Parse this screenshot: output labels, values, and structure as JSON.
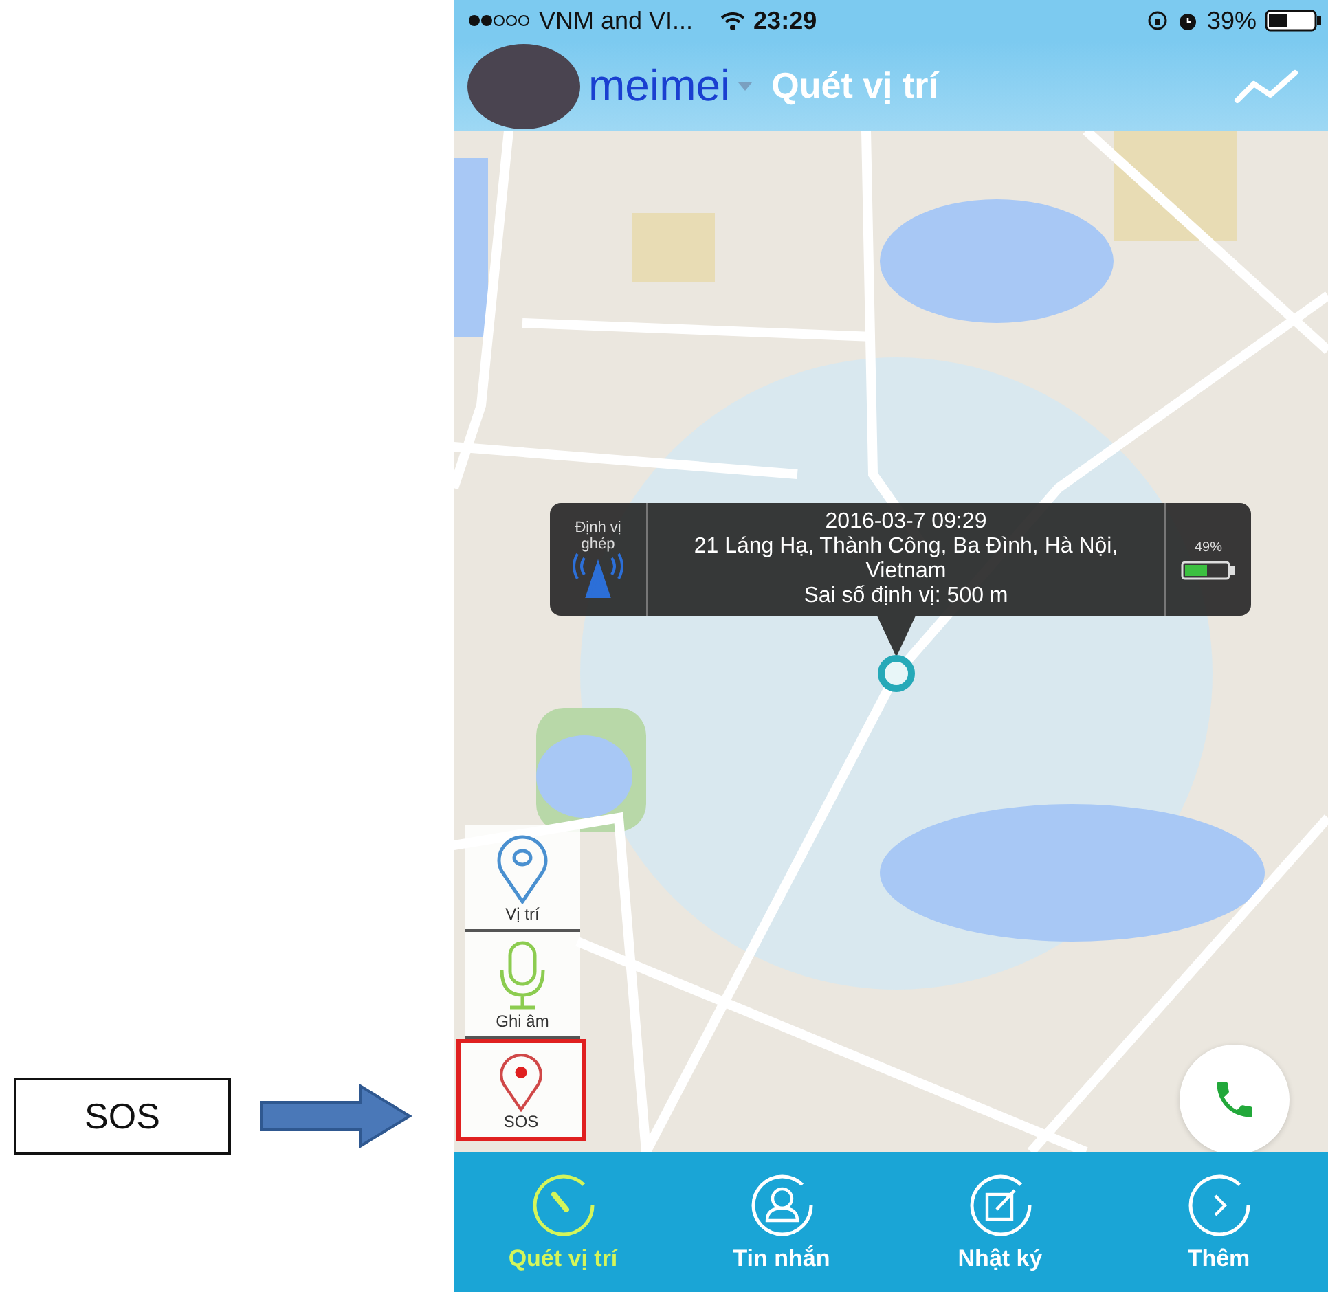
{
  "annotation": {
    "label": "SOS"
  },
  "status_bar": {
    "carrier": "VNM and VI...",
    "time": "23:29",
    "battery": "39%"
  },
  "header": {
    "user": "meimei",
    "title": "Quét vị trí"
  },
  "popup": {
    "mode": "Định vị ghép",
    "datetime": "2016-03-7 09:29",
    "address": "21 Láng Hạ, Thành Công, Ba Đình, Hà Nội, Vietnam",
    "accuracy": "Sai số định vị: 500 m",
    "battery": "49%"
  },
  "side_buttons": [
    {
      "kind": "location",
      "label": "Vị trí",
      "highlighted": false
    },
    {
      "kind": "record",
      "label": "Ghi âm",
      "highlighted": false
    },
    {
      "kind": "sos",
      "label": "SOS",
      "highlighted": true
    }
  ],
  "tabs": [
    {
      "kind": "scan",
      "label": "Quét vị trí",
      "selected": true
    },
    {
      "kind": "chat",
      "label": "Tin nhắn",
      "selected": false
    },
    {
      "kind": "diary",
      "label": "Nhật ký",
      "selected": false
    },
    {
      "kind": "more",
      "label": "Thêm",
      "selected": false
    }
  ]
}
